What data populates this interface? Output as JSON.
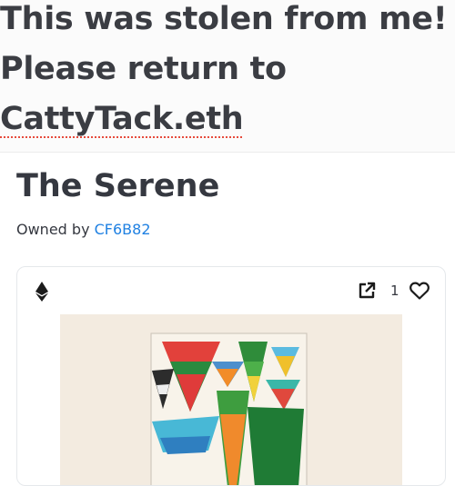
{
  "banner": {
    "line1": "This was stolen from me!",
    "line2": "Please return to",
    "line3": "CattyTack.eth"
  },
  "nft": {
    "title": "The Serene",
    "owned_by_label": "Owned by",
    "owner": "CF6B82",
    "favorites_count": "1"
  },
  "icons": {
    "chain": "ethereum-icon",
    "external": "external-link-icon",
    "favorite": "heart-icon"
  },
  "colors": {
    "link": "#2081e2",
    "text": "#353840",
    "artwork_background": "#f3ebe0"
  }
}
